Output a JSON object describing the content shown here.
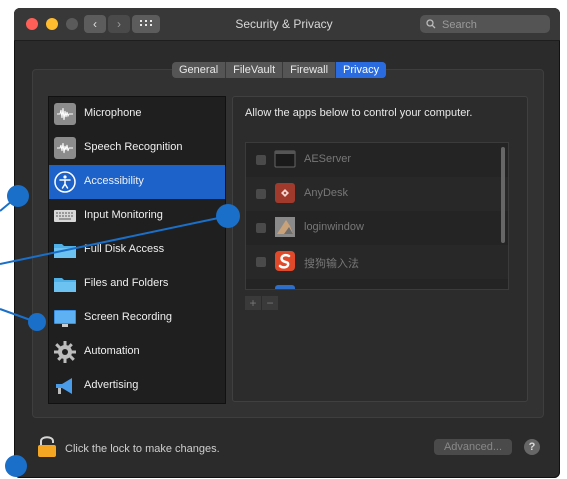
{
  "window": {
    "title": "Security & Privacy",
    "search_placeholder": "Search"
  },
  "tabs": [
    {
      "label": "General",
      "active": false
    },
    {
      "label": "FileVault",
      "active": false
    },
    {
      "label": "Firewall",
      "active": false
    },
    {
      "label": "Privacy",
      "active": true
    }
  ],
  "sidebar": {
    "items": [
      {
        "label": "Microphone",
        "icon": "microphone-icon",
        "selected": false
      },
      {
        "label": "Speech Recognition",
        "icon": "speech-waveform-icon",
        "selected": false
      },
      {
        "label": "Accessibility",
        "icon": "accessibility-icon",
        "selected": true
      },
      {
        "label": "Input Monitoring",
        "icon": "keyboard-icon",
        "selected": false
      },
      {
        "label": "Full Disk Access",
        "icon": "folder-icon",
        "selected": false
      },
      {
        "label": "Files and Folders",
        "icon": "folder-icon",
        "selected": false
      },
      {
        "label": "Screen Recording",
        "icon": "display-icon",
        "selected": false
      },
      {
        "label": "Automation",
        "icon": "gear-icon",
        "selected": false
      },
      {
        "label": "Advertising",
        "icon": "megaphone-icon",
        "selected": false
      }
    ]
  },
  "main": {
    "description": "Allow the apps below to control your computer.",
    "apps": [
      {
        "name": "AEServer",
        "checked": false,
        "icon": "terminal-app-icon"
      },
      {
        "name": "AnyDesk",
        "checked": false,
        "icon": "anydesk-app-icon"
      },
      {
        "name": "loginwindow",
        "checked": false,
        "icon": "loginwindow-app-icon"
      },
      {
        "name": "搜狗输入法",
        "checked": false,
        "icon": "sogou-app-icon"
      }
    ],
    "add_label": "+",
    "remove_label": "−"
  },
  "footer": {
    "lock_text": "Click the lock to make changes.",
    "advanced_label": "Advanced...",
    "help_label": "?"
  },
  "colors": {
    "selection": "#1c62c9",
    "tab_active": "#2a6ce0",
    "annotation": "#1a6fc9"
  }
}
